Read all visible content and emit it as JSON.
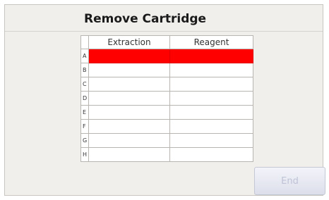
{
  "dialog": {
    "title": "Remove Cartridge"
  },
  "table": {
    "headers": [
      "Extraction",
      "Reagent"
    ],
    "rows": [
      {
        "letter": "A",
        "highlighted": true
      },
      {
        "letter": "B",
        "highlighted": false
      },
      {
        "letter": "C",
        "highlighted": false
      },
      {
        "letter": "D",
        "highlighted": false
      },
      {
        "letter": "E",
        "highlighted": false
      },
      {
        "letter": "F",
        "highlighted": false
      },
      {
        "letter": "G",
        "highlighted": false
      },
      {
        "letter": "H",
        "highlighted": false
      }
    ],
    "highlight_color": "#ff0000"
  },
  "footer": {
    "end_label": "End",
    "end_enabled": false
  }
}
